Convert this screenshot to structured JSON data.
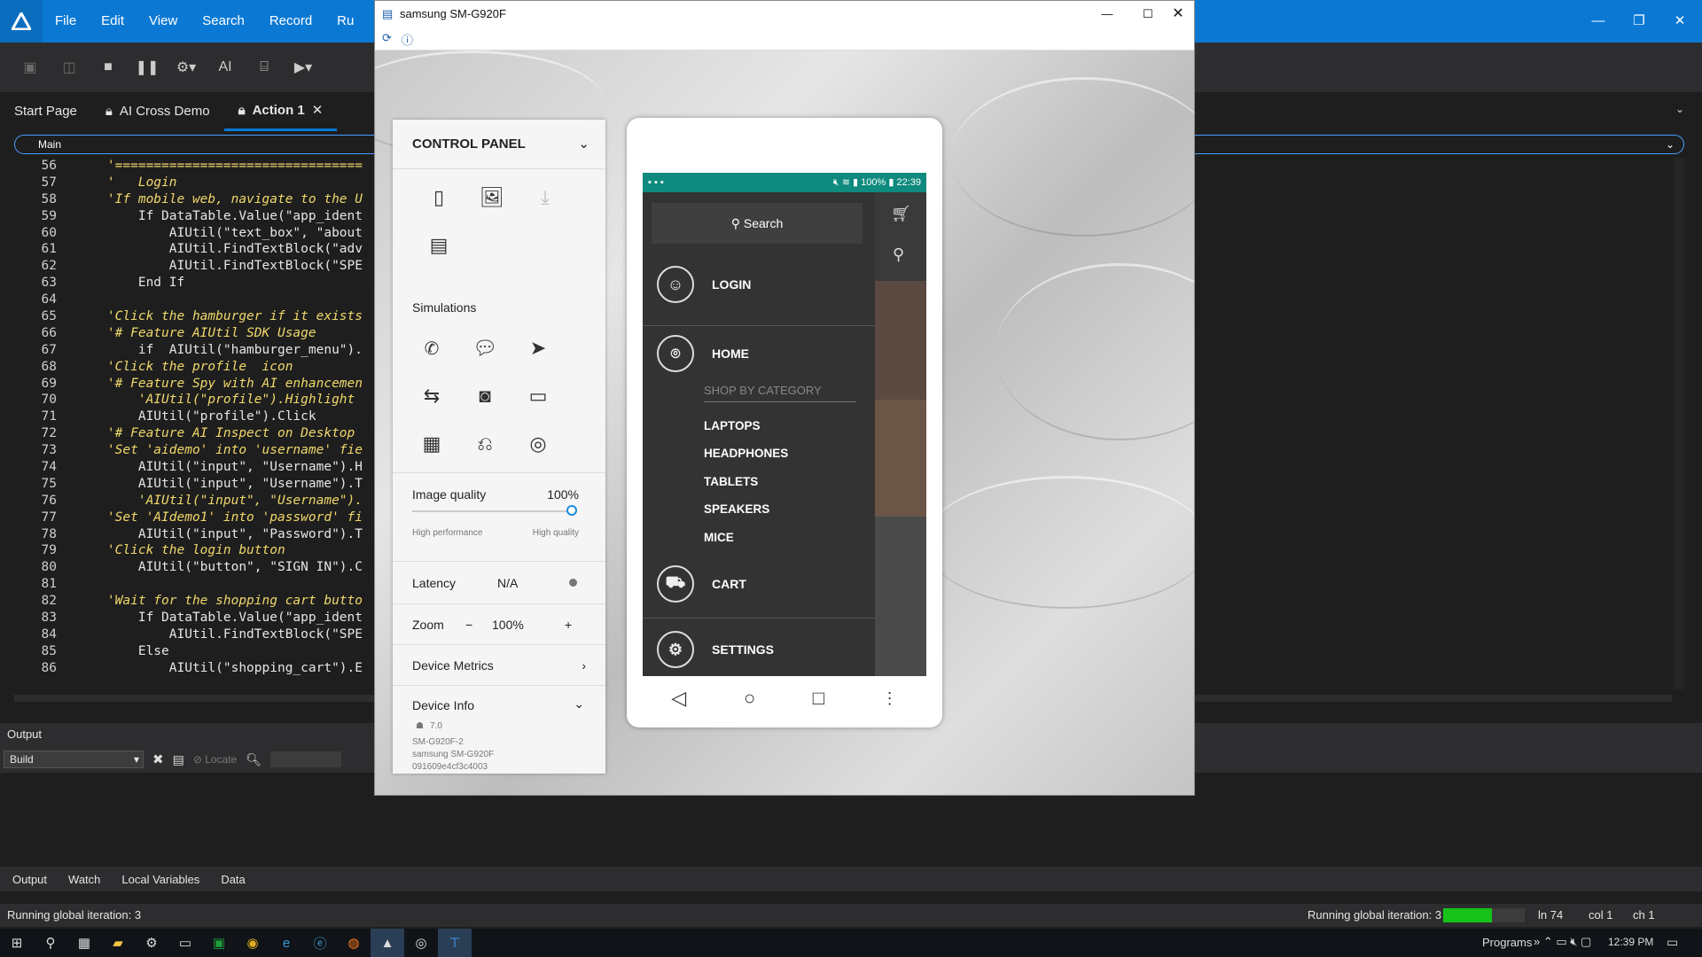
{
  "menubar": {
    "items": [
      "File",
      "Edit",
      "View",
      "Search",
      "Record",
      "Ru"
    ]
  },
  "tabs": [
    {
      "label": "Start Page"
    },
    {
      "label": "AI Cross Demo"
    },
    {
      "label": "Action 1"
    }
  ],
  "toolbar": {
    "ai_label": "AI"
  },
  "funcbar": {
    "label": "Main"
  },
  "code": {
    "lines": [
      {
        "n": "56",
        "t": "    '================================"
      },
      {
        "n": "57",
        "t": "    '   Login"
      },
      {
        "n": "58",
        "t": "    'If mobile web, navigate to the U"
      },
      {
        "n": "59",
        "t": "        If DataTable.Value(\"app_ident"
      },
      {
        "n": "60",
        "t": "            AIUtil(\"text_box\", \"about"
      },
      {
        "n": "61",
        "t": "            AIUtil.FindTextBlock(\"adv"
      },
      {
        "n": "62",
        "t": "            AIUtil.FindTextBlock(\"SPE"
      },
      {
        "n": "63",
        "t": "        End If"
      },
      {
        "n": "64",
        "t": ""
      },
      {
        "n": "65",
        "t": "    'Click the hamburger if it exists"
      },
      {
        "n": "66",
        "t": "    '# Feature AIUtil SDK Usage"
      },
      {
        "n": "67",
        "t": "        if  AIUtil(\"hamburger_menu\")."
      },
      {
        "n": "68",
        "t": "    'Click the profile  icon"
      },
      {
        "n": "69",
        "t": "    '# Feature Spy with AI enhancemen"
      },
      {
        "n": "70",
        "t": "        'AIUtil(\"profile\").Highlight"
      },
      {
        "n": "71",
        "t": "        AIUtil(\"profile\").Click"
      },
      {
        "n": "72",
        "t": "    '# Feature AI Inspect on Desktop "
      },
      {
        "n": "73",
        "t": "    'Set 'aidemo' into 'username' fie"
      },
      {
        "n": "74",
        "t": "        AIUtil(\"input\", \"Username\").H"
      },
      {
        "n": "75",
        "t": "        AIUtil(\"input\", \"Username\").T"
      },
      {
        "n": "76",
        "t": "        'AIUtil(\"input\", \"Username\")."
      },
      {
        "n": "77",
        "t": "    'Set 'AIdemo1' into 'password' fi"
      },
      {
        "n": "78",
        "t": "        AIUtil(\"input\", \"Password\").T"
      },
      {
        "n": "79",
        "t": "    'Click the login button"
      },
      {
        "n": "80",
        "t": "        AIUtil(\"button\", \"SIGN IN\").C"
      },
      {
        "n": "81",
        "t": ""
      },
      {
        "n": "82",
        "t": "    'Wait for the shopping cart butto"
      },
      {
        "n": "83",
        "t": "        If DataTable.Value(\"app_ident"
      },
      {
        "n": "84",
        "t": "            AIUtil.FindTextBlock(\"SPE"
      },
      {
        "n": "85",
        "t": "        Else"
      },
      {
        "n": "86",
        "t": "            AIUtil(\"shopping_cart\").E"
      }
    ]
  },
  "output": {
    "title": "Output",
    "build_select": "Build",
    "locate_label": "Locate"
  },
  "bottom_tabs": [
    "Output",
    "Watch",
    "Local Variables",
    "Data"
  ],
  "status": {
    "left": "Running global iteration: 3",
    "right": "Running global iteration: 3",
    "progress": 0.6,
    "ln": "ln 74",
    "col": "col 1",
    "ch": "ch 1"
  },
  "taskbar": {
    "programs": "Programs",
    "time": "12:39 PM"
  },
  "device_window": {
    "title": "samsung SM-G920F",
    "control_panel": {
      "title": "CONTROL PANEL",
      "simulations": "Simulations",
      "image_quality_label": "Image quality",
      "image_quality_value": "100%",
      "image_quality_level": 1.0,
      "high_performance": "High performance",
      "high_quality": "High quality",
      "latency_label": "Latency",
      "latency_value": "N/A",
      "zoom_label": "Zoom",
      "zoom_minus": "−",
      "zoom_value": "100%",
      "zoom_plus": "+",
      "device_metrics": "Device Metrics",
      "device_info": "Device Info",
      "os_version": "7.0",
      "model_code": "SM-G920F-2",
      "device_name": "samsung SM-G920F",
      "serial": "091609e4cf3c4003"
    },
    "phone": {
      "status_time": "22:39",
      "battery": "100%",
      "search": "Search",
      "login": "LOGIN",
      "home": "HOME",
      "shop_by_category": "SHOP BY CATEGORY",
      "categories": [
        "LAPTOPS",
        "HEADPHONES",
        "TABLETS",
        "SPEAKERS",
        "MICE"
      ],
      "cart": "CART",
      "settings": "SETTINGS"
    }
  }
}
